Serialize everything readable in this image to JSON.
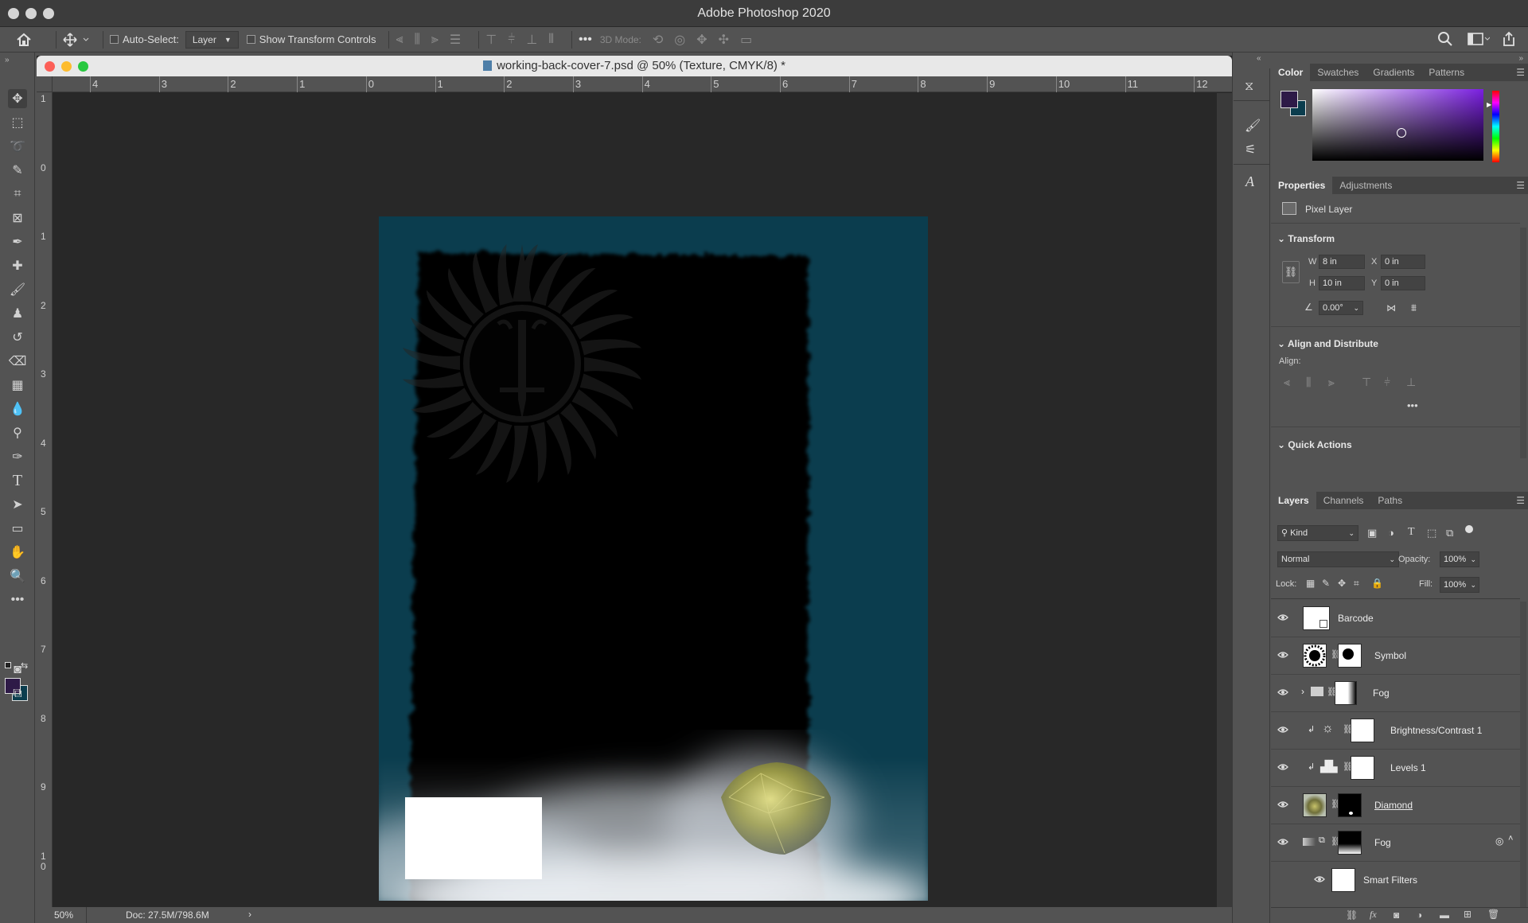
{
  "app": {
    "title": "Adobe Photoshop 2020"
  },
  "options": {
    "auto_select_label": "Auto-Select:",
    "auto_select_value": "Layer",
    "show_transform_label": "Show Transform Controls",
    "mode_3d_label": "3D Mode:"
  },
  "document": {
    "title": "working-back-cover-7.psd @ 50% (Texture, CMYK/8) *",
    "zoom": "50%",
    "doc_size": "Doc: 27.5M/798.6M",
    "ruler_h": [
      "4",
      "3",
      "2",
      "1",
      "0",
      "1",
      "2",
      "3",
      "4",
      "5",
      "6",
      "7",
      "8",
      "9",
      "10",
      "11",
      "12"
    ],
    "ruler_v": [
      "1",
      "0",
      "1",
      "2",
      "3",
      "4",
      "5",
      "6",
      "7",
      "8",
      "9",
      "1\n0"
    ]
  },
  "color_panel": {
    "tabs": [
      "Color",
      "Swatches",
      "Gradients",
      "Patterns"
    ],
    "foreground": "#2e1a47",
    "background": "#0b3d4e"
  },
  "properties": {
    "tabs": [
      "Properties",
      "Adjustments"
    ],
    "layer_type": "Pixel Layer",
    "transform_title": "Transform",
    "w_label": "W",
    "w": "8 in",
    "h_label": "H",
    "h": "10 in",
    "x_label": "X",
    "x": "0 in",
    "y_label": "Y",
    "y": "0 in",
    "angle": "0.00°",
    "align_title": "Align and Distribute",
    "align_label": "Align:",
    "quick_actions": "Quick Actions"
  },
  "layers_panel": {
    "tabs": [
      "Layers",
      "Channels",
      "Paths"
    ],
    "kind": "Kind",
    "blend_mode": "Normal",
    "opacity_label": "Opacity:",
    "opacity": "100%",
    "lock_label": "Lock:",
    "fill_label": "Fill:",
    "fill": "100%",
    "layers": [
      {
        "name": "Barcode"
      },
      {
        "name": "Symbol"
      },
      {
        "name": "Fog"
      },
      {
        "name": "Brightness/Contrast 1"
      },
      {
        "name": "Levels 1"
      },
      {
        "name": "Diamond"
      },
      {
        "name": "Fog"
      },
      {
        "name": "Smart Filters"
      }
    ]
  }
}
